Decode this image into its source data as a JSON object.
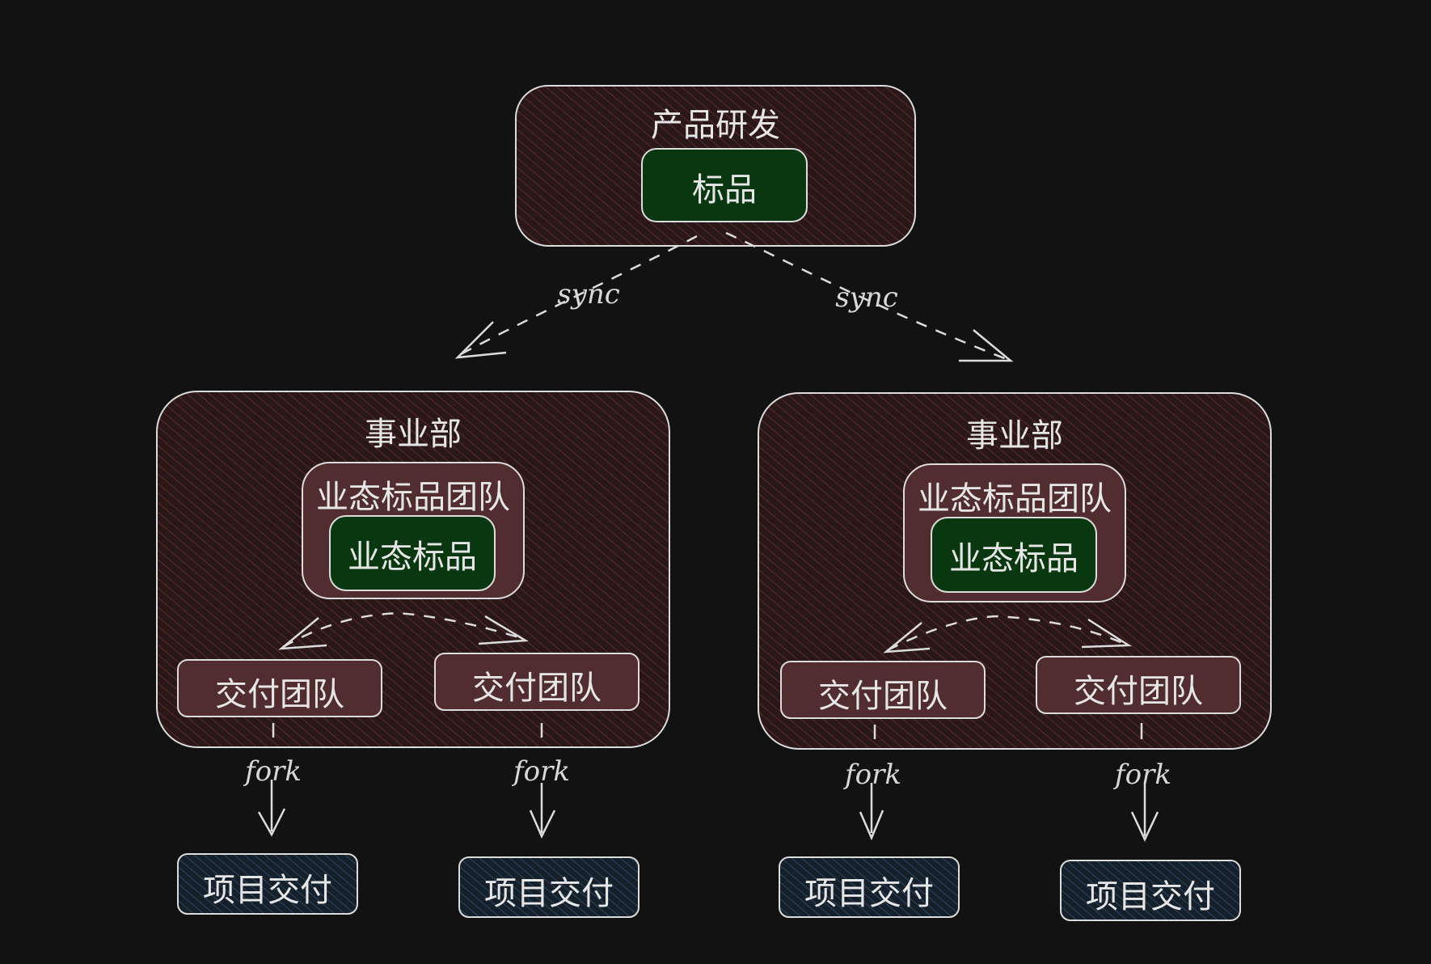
{
  "colors": {
    "background": "#121212",
    "stroke": "#dcdcdc",
    "org_fill": "#2a1718",
    "org_hatch": "#5a2a2e",
    "team_fill": "#522d2f",
    "product_fill": "#093810",
    "delivery_fill": "#16202b",
    "delivery_hatch": "#2a4660"
  },
  "top": {
    "title": "产品研发",
    "product": "标品"
  },
  "sync_label": "sync",
  "fork_label": "fork",
  "divisions": [
    {
      "title": "事业部",
      "team": "业态标品团队",
      "product": "业态标品",
      "delivery_teams": [
        "交付团队",
        "交付团队"
      ]
    },
    {
      "title": "事业部",
      "team": "业态标品团队",
      "product": "业态标品",
      "delivery_teams": [
        "交付团队",
        "交付团队"
      ]
    }
  ],
  "projects": [
    "项目交付",
    "项目交付",
    "项目交付",
    "项目交付"
  ]
}
